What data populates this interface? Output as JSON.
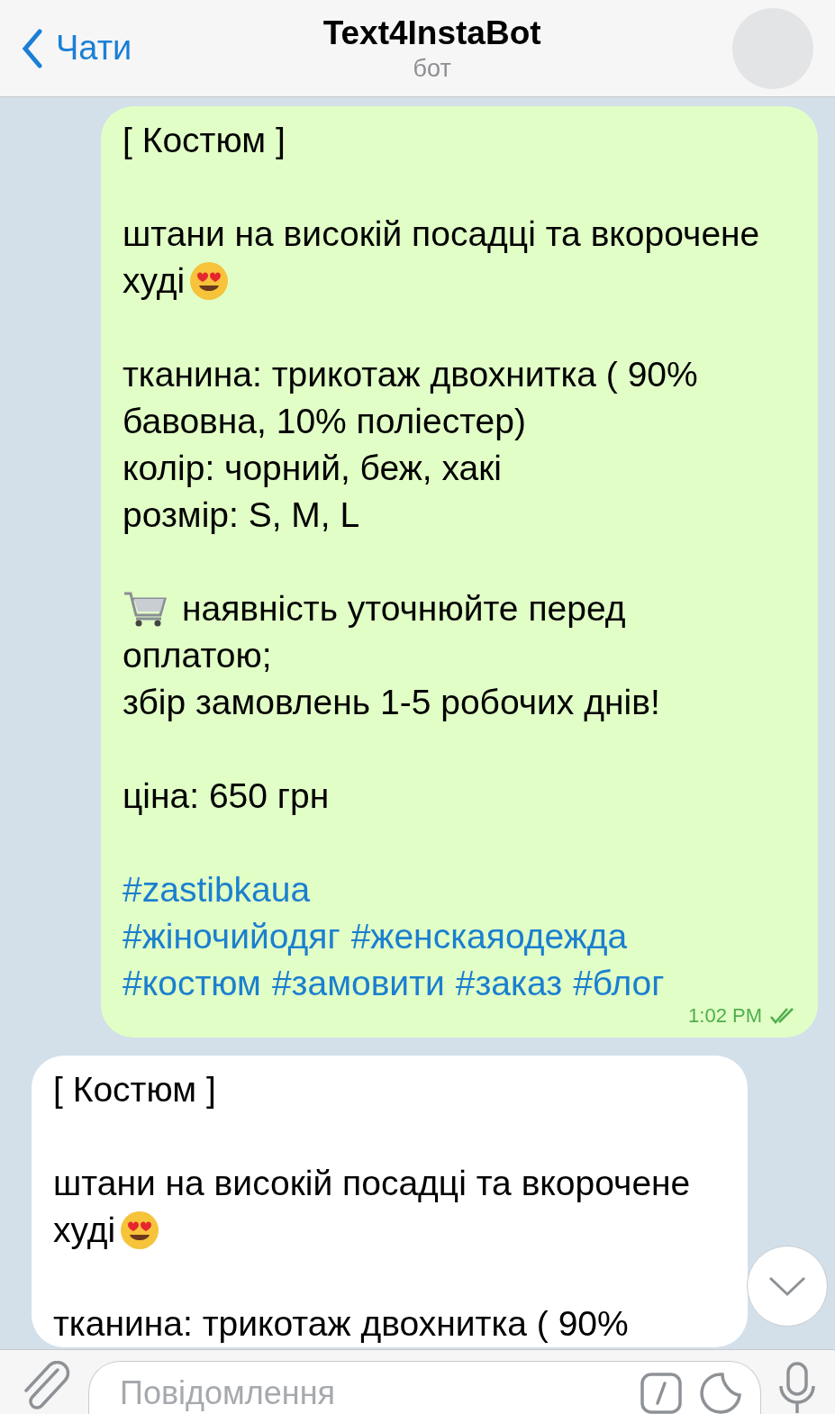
{
  "header": {
    "back_label": "Чати",
    "title": "Text4InstaBot",
    "subtitle": "бот"
  },
  "messages": [
    {
      "outgoing": true,
      "time": "1:02 PM",
      "read": true,
      "paragraphs": [
        [
          [
            {
              "kind": "text",
              "text": "[ Костюм ]"
            }
          ]
        ],
        [
          [
            {
              "kind": "text",
              "text": "штани на високій посадці та вкорочене"
            }
          ],
          [
            {
              "kind": "text",
              "text": "худі"
            },
            {
              "kind": "heart_eyes"
            }
          ]
        ],
        [
          [
            {
              "kind": "text",
              "text": "тканина: трикотаж двохнитка ( 90%"
            }
          ],
          [
            {
              "kind": "text",
              "text": "бавовна, 10% поліестер)"
            }
          ],
          [
            {
              "kind": "text",
              "text": "колір: чорний, беж, хакі"
            }
          ],
          [
            {
              "kind": "text",
              "text": "розмір: S, M, L"
            }
          ]
        ],
        [
          [
            {
              "kind": "cart"
            },
            {
              "kind": "text",
              "text": "наявність уточнюйте перед"
            }
          ],
          [
            {
              "kind": "text",
              "text": "оплатою;"
            }
          ],
          [
            {
              "kind": "text",
              "text": "збір замовлень 1-5 робочих днів!"
            }
          ]
        ],
        [
          [
            {
              "kind": "text",
              "text": "ціна: 650 грн"
            }
          ]
        ],
        [
          [
            {
              "kind": "hashtag",
              "text": "#zastibkaua"
            }
          ],
          [
            {
              "kind": "hashtag",
              "text": "#жіночийодяг"
            },
            {
              "kind": "hashtag",
              "text": "#женскаяодежда"
            }
          ],
          [
            {
              "kind": "hashtag",
              "text": "#костюм"
            },
            {
              "kind": "hashtag",
              "text": "#замовити"
            },
            {
              "kind": "hashtag",
              "text": "#заказ"
            },
            {
              "kind": "hashtag",
              "text": "#блог"
            }
          ]
        ]
      ]
    },
    {
      "outgoing": false,
      "paragraphs": [
        [
          [
            {
              "kind": "text",
              "text": "[ Костюм ]"
            }
          ]
        ],
        [
          [
            {
              "kind": "text",
              "text": "штани на високій посадці та вкорочене"
            }
          ],
          [
            {
              "kind": "text",
              "text": "худі"
            },
            {
              "kind": "heart_eyes"
            }
          ]
        ],
        [
          [
            {
              "kind": "text",
              "text": "тканина: трикотаж двохнитка ( 90%"
            }
          ]
        ]
      ]
    }
  ],
  "composer": {
    "placeholder": "Повідомлення"
  }
}
